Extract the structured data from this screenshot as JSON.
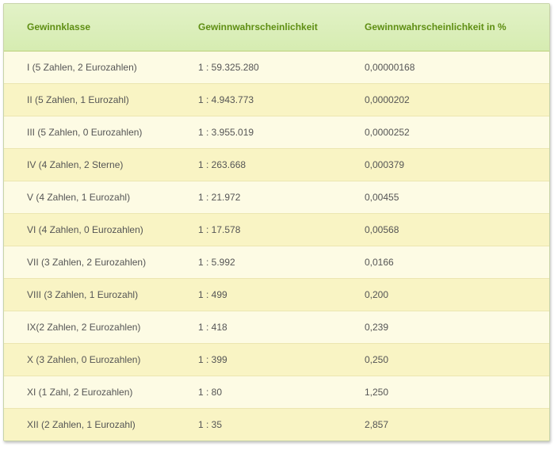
{
  "header": {
    "col1": "Gewinnklasse",
    "col2": "Gewinnwahrscheinlichkeit",
    "col3": "Gewinnwahrscheinlichkeit in %"
  },
  "rows": [
    {
      "klasse": "I (5 Zahlen, 2 Eurozahlen)",
      "chance": "1 : 59.325.280",
      "prozent": "0,00000168"
    },
    {
      "klasse": "II (5 Zahlen, 1 Eurozahl)",
      "chance": "1 : 4.943.773",
      "prozent": "0,0000202"
    },
    {
      "klasse": "III (5 Zahlen, 0 Eurozahlen)",
      "chance": "1 : 3.955.019",
      "prozent": "0,0000252"
    },
    {
      "klasse": "IV (4 Zahlen, 2 Sterne)",
      "chance": "1 : 263.668",
      "prozent": "0,000379"
    },
    {
      "klasse": "V (4 Zahlen, 1 Eurozahl)",
      "chance": "1 : 21.972",
      "prozent": "0,00455"
    },
    {
      "klasse": "VI (4 Zahlen, 0 Eurozahlen)",
      "chance": "1 : 17.578",
      "prozent": "0,00568"
    },
    {
      "klasse": "VII (3 Zahlen, 2 Eurozahlen)",
      "chance": "1 : 5.992",
      "prozent": "0,0166"
    },
    {
      "klasse": "VIII (3 Zahlen, 1 Eurozahl)",
      "chance": "1 : 499",
      "prozent": "0,200"
    },
    {
      "klasse": "IX(2 Zahlen, 2 Eurozahlen)",
      "chance": "1 : 418",
      "prozent": "0,239"
    },
    {
      "klasse": "X (3 Zahlen, 0 Eurozahlen)",
      "chance": "1 : 399",
      "prozent": "0,250"
    },
    {
      "klasse": "XI (1 Zahl, 2 Eurozahlen)",
      "chance": "1 : 80",
      "prozent": "1,250"
    },
    {
      "klasse": "XII (2 Zahlen, 1 Eurozahl)",
      "chance": "1 : 35",
      "prozent": "2,857"
    }
  ],
  "colors": {
    "header_text": "#5e8e12",
    "header_bg": "#d6ecb1",
    "row_odd": "#fdfbe4",
    "row_even": "#f9f4c4",
    "body_text": "#555555"
  }
}
